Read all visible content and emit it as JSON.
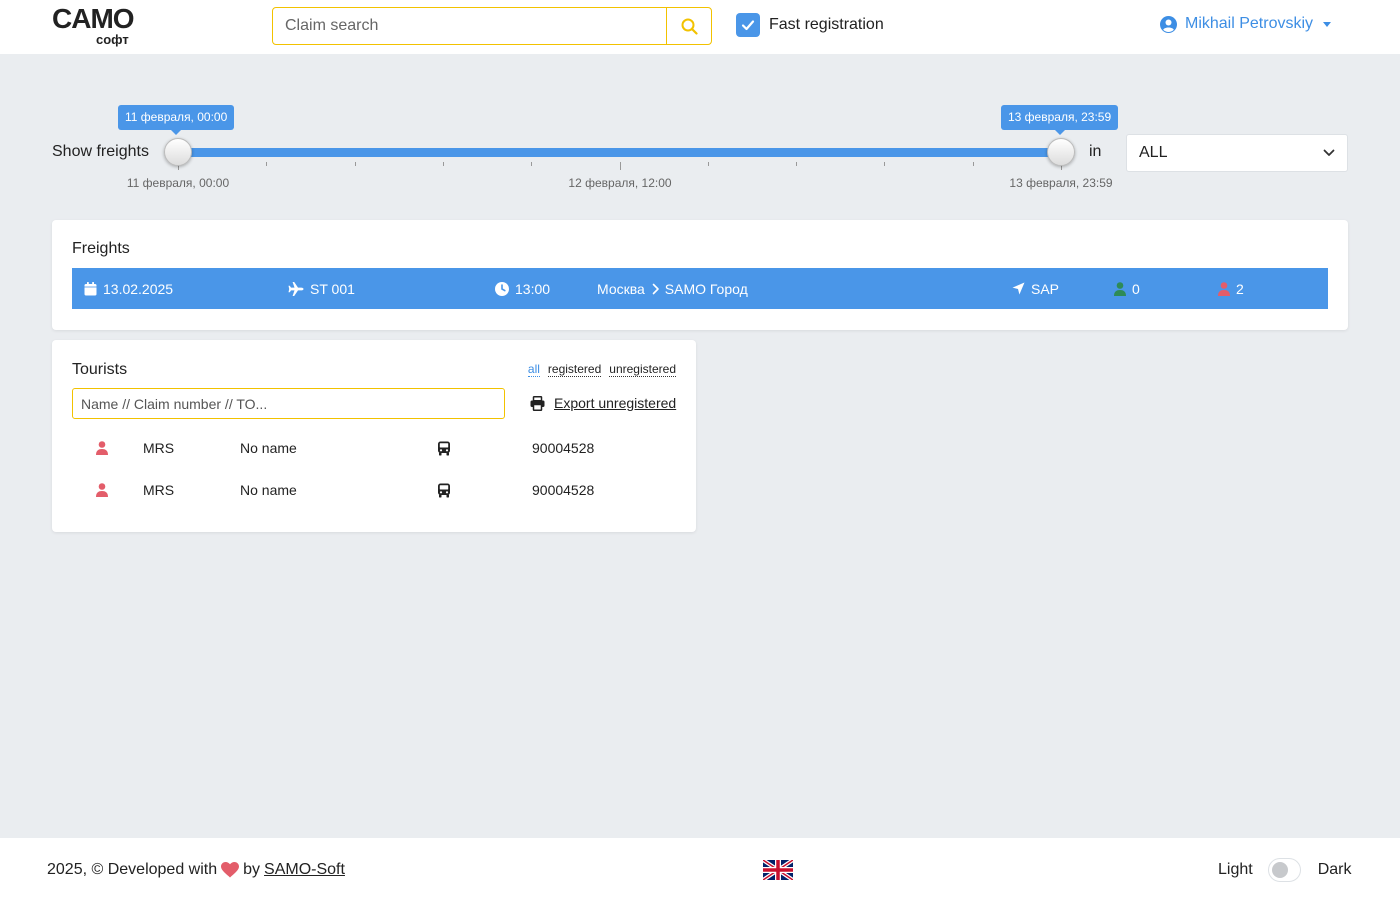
{
  "header": {
    "logo_main": "CAMO",
    "logo_sub": "софт",
    "search_placeholder": "Claim search",
    "fast_registration_label": "Fast registration",
    "user_name": "Mikhail Petrovskiy"
  },
  "slider": {
    "label": "Show freights",
    "start_tooltip": "11 февраля, 00:00",
    "end_tooltip": "13 февраля, 23:59",
    "ticks_labels": [
      "11 февраля, 00:00",
      "12 февраля, 12:00",
      "13 февраля, 23:59"
    ],
    "in_label": "in",
    "select_value": "ALL"
  },
  "freights": {
    "title": "Freights",
    "row": {
      "date": "13.02.2025",
      "flight": "ST 001",
      "time": "13:00",
      "from": "Москва",
      "to": "SAMO Город",
      "destination_code": "SAP",
      "registered_count": "0",
      "unregistered_count": "2"
    }
  },
  "tourists": {
    "title": "Tourists",
    "filters": [
      "all",
      "registered",
      "unregistered"
    ],
    "active_filter": "all",
    "search_placeholder": "Name // Claim number // TO...",
    "export_label": "Export unregistered",
    "rows": [
      {
        "title": "MRS",
        "name": "No name",
        "claim": "90004528"
      },
      {
        "title": "MRS",
        "name": "No name",
        "claim": "90004528"
      }
    ]
  },
  "footer": {
    "copyright_prefix": "2025, © Developed with",
    "by": "by",
    "company": "SAMO-Soft",
    "theme_light": "Light",
    "theme_dark": "Dark"
  },
  "colors": {
    "accent": "#4a96e8",
    "search_border": "#f2c200",
    "registered": "#2e8b57",
    "unregistered": "#e35d6a"
  }
}
